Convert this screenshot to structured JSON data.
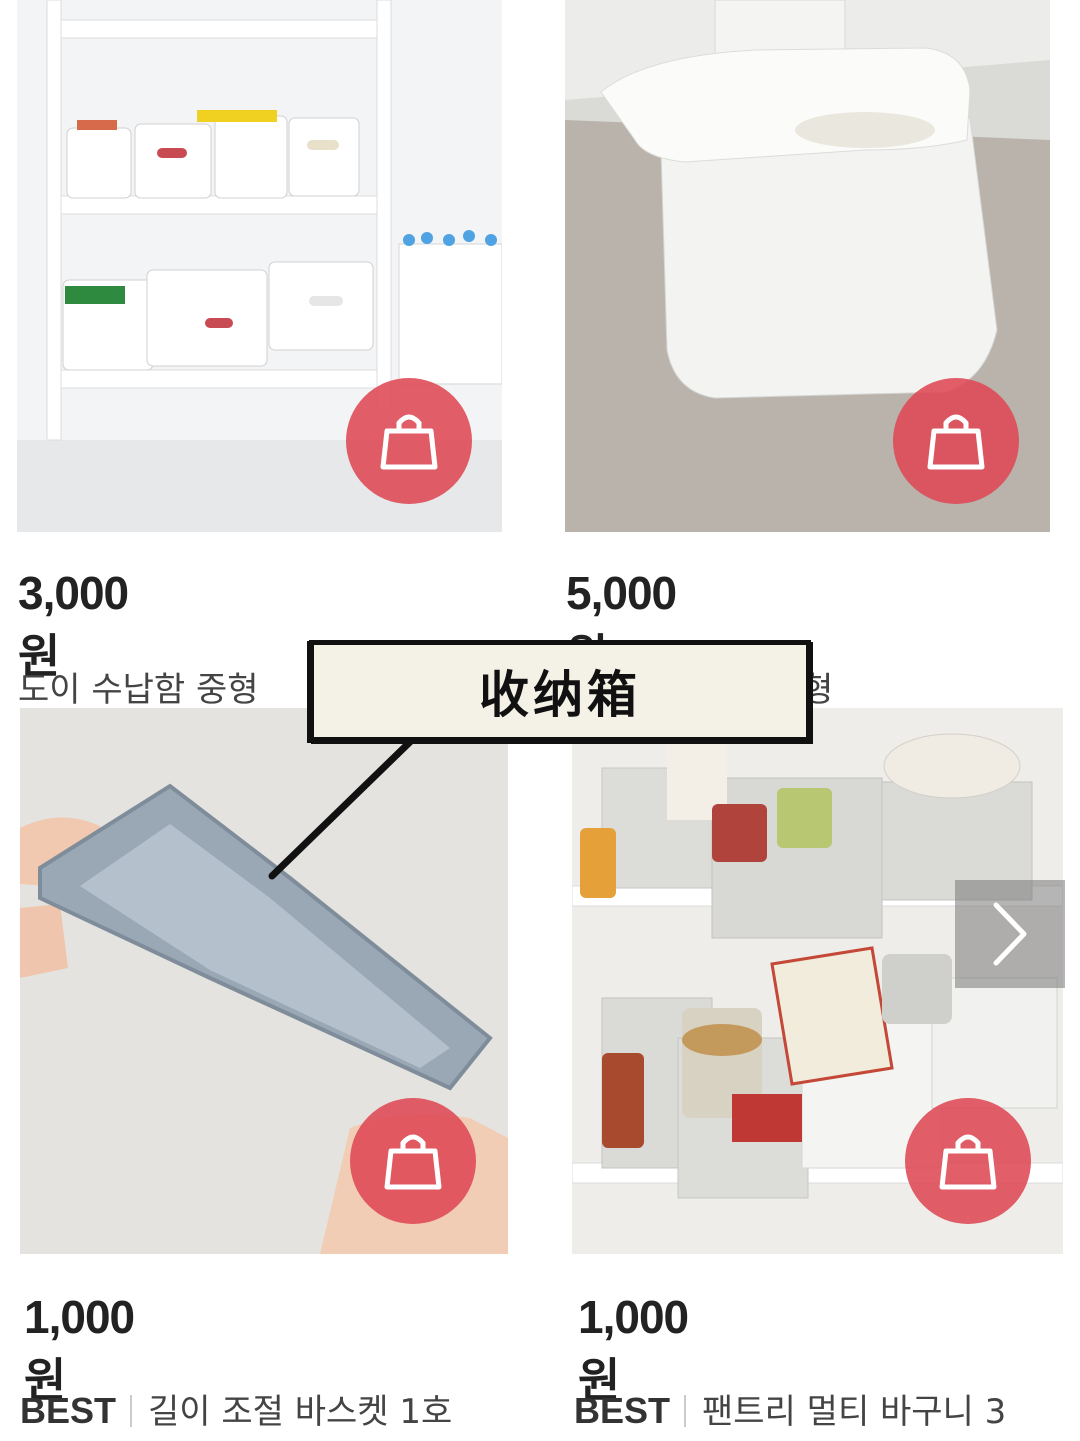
{
  "products": [
    {
      "price": "3,000원",
      "name": "도이 수납함 중형"
    },
    {
      "price": "5,000원",
      "name": "형"
    },
    {
      "badge": "BEST",
      "price": "1,000원",
      "name": "길이 조절 바스켓 1호"
    },
    {
      "badge": "BEST",
      "price": "1,000원",
      "name": "팬트리 멀티 바구니 3"
    }
  ],
  "annotation": {
    "label": "收纳箱"
  },
  "icons": {
    "cart": "shopping-bag-icon",
    "next": "chevron-right-icon"
  },
  "colors": {
    "cart_button": "#de4854",
    "price_text": "#222222"
  }
}
